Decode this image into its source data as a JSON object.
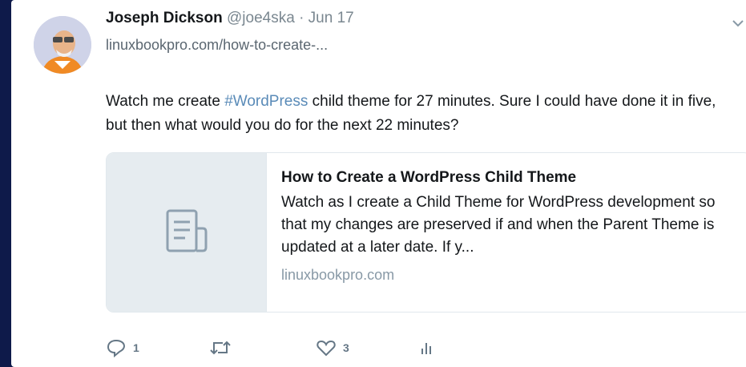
{
  "tweet": {
    "author_name": "Joseph Dickson",
    "handle": "@joe4ska",
    "separator": "·",
    "date": "Jun 17",
    "link_text": "linuxbookpro.com/how-to-create-...",
    "text_before_hashtag": "Watch me create ",
    "hashtag": "#WordPress",
    "text_after_hashtag": " child theme for 27 minutes. Sure I could have done it in five, but then what would you do for the next 22 minutes?"
  },
  "card": {
    "title": "How to Create a WordPress Child Theme",
    "description": "Watch as I create a Child Theme for WordPress development so that my changes are preserved if and when the Parent Theme is updated at a later date. If y...",
    "domain": "linuxbookpro.com",
    "thumbnail_icon": "document-icon"
  },
  "actions": {
    "reply_count": "1",
    "retweet_count": "",
    "like_count": "3",
    "icons": [
      "reply-icon",
      "retweet-icon",
      "like-icon",
      "analytics-icon"
    ]
  },
  "colors": {
    "background": "#0e1a4a",
    "hashtag": "#5a8bb8",
    "muted": "#7a8790",
    "avatar_orange": "#f08a24"
  }
}
